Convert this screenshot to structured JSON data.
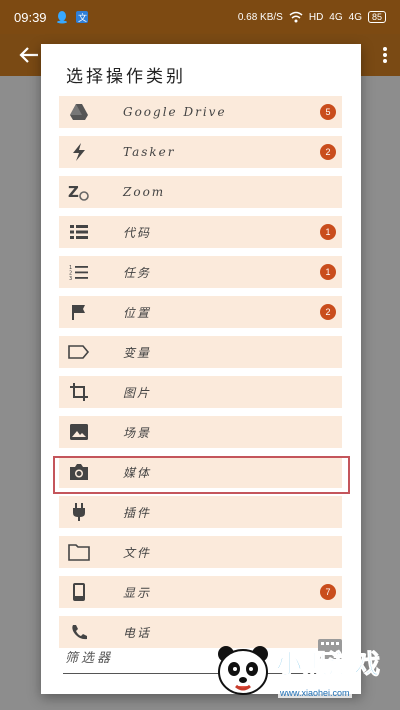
{
  "status_bar": {
    "time": "09:39",
    "net_speed": "0.68 KB/S",
    "network_label": "HD",
    "signal_1": "4G",
    "signal_2": "4G",
    "battery": "85"
  },
  "dialog": {
    "title": "选择操作类别",
    "items": [
      {
        "label": "Google Drive",
        "icon": "google-drive-icon",
        "badge": "5"
      },
      {
        "label": "Tasker",
        "icon": "tasker-bolt-icon",
        "badge": "2"
      },
      {
        "label": "Zoom",
        "icon": "zoom-icon",
        "badge": ""
      },
      {
        "label": "代码",
        "icon": "code-list-icon",
        "badge": "1"
      },
      {
        "label": "任务",
        "icon": "numbered-list-icon",
        "badge": "1"
      },
      {
        "label": "位置",
        "icon": "flag-icon",
        "badge": "2"
      },
      {
        "label": "变量",
        "icon": "tag-icon",
        "badge": ""
      },
      {
        "label": "图片",
        "icon": "crop-icon",
        "badge": ""
      },
      {
        "label": "场景",
        "icon": "image-icon",
        "badge": ""
      },
      {
        "label": "媒体",
        "icon": "camera-icon",
        "badge": ""
      },
      {
        "label": "插件",
        "icon": "plug-icon",
        "badge": ""
      },
      {
        "label": "文件",
        "icon": "folder-icon",
        "badge": ""
      },
      {
        "label": "显示",
        "icon": "phone-icon",
        "badge": "7"
      },
      {
        "label": "电话",
        "icon": "phone-handset-icon",
        "badge": ""
      }
    ],
    "filter_placeholder": "筛选器"
  },
  "watermark": {
    "brand": "小黑游戏",
    "url": "www.xiaohei.com"
  },
  "colors": {
    "appbar": "#7a4a14",
    "item_bg": "#fbeadb",
    "badge": "#c94d1c",
    "highlight": "#c4555b"
  }
}
